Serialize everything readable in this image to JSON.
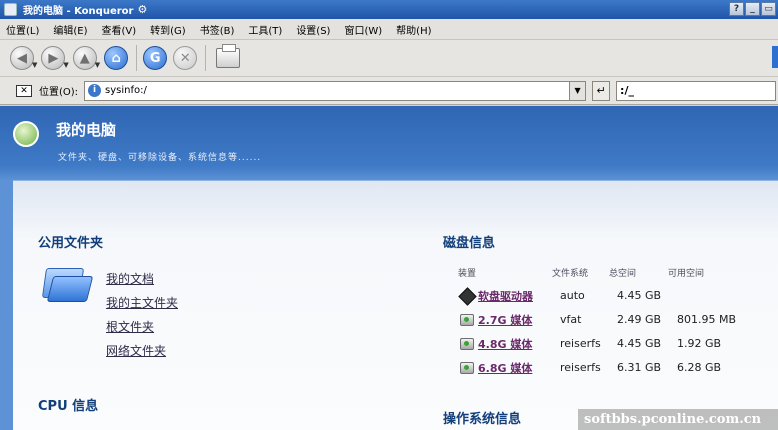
{
  "window": {
    "title": "我的电脑 - Konqueror",
    "buttons": [
      "?",
      "_",
      "▭"
    ]
  },
  "menu": [
    "位置(L)",
    "编辑(E)",
    "查看(V)",
    "转到(G)",
    "书签(B)",
    "工具(T)",
    "设置(S)",
    "窗口(W)",
    "帮助(H)"
  ],
  "toolbar": {
    "back": "◀",
    "forward": "▶",
    "up": "▲",
    "home": "⌂",
    "reload": "G",
    "stop": "✕"
  },
  "location": {
    "label": "位置(O):",
    "value": "sysinfo:/",
    "mini_value": ":/_"
  },
  "banner": {
    "title": "我的电脑",
    "subtitle": "文件夹、硬盘、可移除设备、系统信息等......"
  },
  "folders": {
    "heading": "公用文件夹",
    "links": [
      "我的文档",
      "我的主文件夹",
      "根文件夹",
      "网络文件夹"
    ]
  },
  "cpu": {
    "heading": "CPU 信息"
  },
  "disks": {
    "heading": "磁盘信息",
    "columns": [
      "装置",
      "文件系统",
      "总空间",
      "可用空间"
    ],
    "rows": [
      {
        "device": "软盘驱动器",
        "fs": "auto",
        "total": "4.45 GB",
        "free": ""
      },
      {
        "device": "2.7G 媒体",
        "fs": "vfat",
        "total": "2.49 GB",
        "free": "801.95 MB"
      },
      {
        "device": "4.8G 媒体",
        "fs": "reiserfs",
        "total": "4.45 GB",
        "free": "1.92 GB"
      },
      {
        "device": "6.8G 媒体",
        "fs": "reiserfs",
        "total": "6.31 GB",
        "free": "6.28 GB"
      }
    ]
  },
  "os": {
    "heading": "操作系统信息"
  },
  "watermark": "softbbs.pconline.com.cn"
}
